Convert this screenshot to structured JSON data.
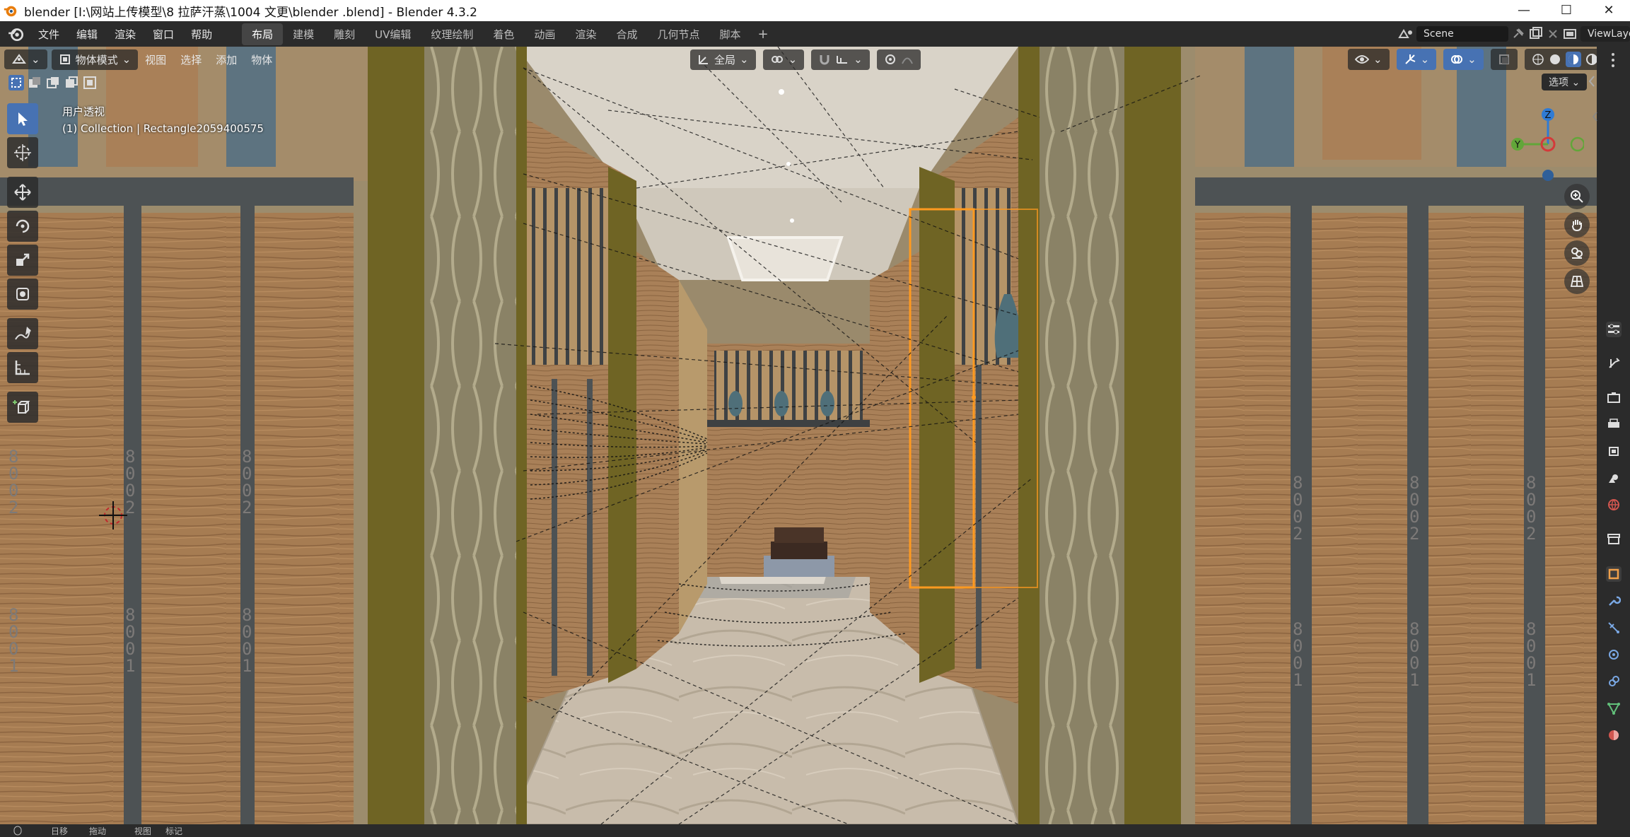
{
  "window": {
    "title": "blender  [I:\\网站上传模型\\8 拉萨汗蒸\\1004 文更\\blender .blend] - Blender 4.3.2",
    "controls": [
      "—",
      "☐",
      "✕"
    ]
  },
  "menubar": {
    "menus": [
      "文件",
      "编辑",
      "渲染",
      "窗口",
      "帮助"
    ],
    "workspaces": [
      "布局",
      "建模",
      "雕刻",
      "UV编辑",
      "纹理绘制",
      "着色",
      "动画",
      "渲染",
      "合成",
      "几何节点",
      "脚本"
    ],
    "active_workspace": "布局",
    "add_label": "+",
    "scene_label": "Scene",
    "viewlayer_label": "ViewLayer"
  },
  "viewport_header": {
    "mode_label": "物体模式",
    "menus": [
      "视图",
      "选择",
      "添加",
      "物体"
    ],
    "transform_orientation": "全局",
    "options_label": "选项"
  },
  "overlay": {
    "view_name": "用户透视",
    "collection_info": "(1) Collection | Rectangle2059400575"
  },
  "toolbar": {
    "tools": [
      "select-box",
      "cursor",
      "move",
      "rotate",
      "scale",
      "transform",
      "annotate",
      "measure",
      "add-cube"
    ]
  },
  "gizmo": {
    "x_label": "Y",
    "z_label": "Z"
  },
  "wall_numbers": {
    "top": "8002",
    "bottom": "8001"
  },
  "status": {
    "items": [
      "日移",
      "拖动",
      "视图",
      "标记"
    ]
  },
  "colors": {
    "accent": "#4772b3",
    "wood": "#a67c52",
    "olive": "#6f6424",
    "select_orange": "#ff9a1f"
  }
}
